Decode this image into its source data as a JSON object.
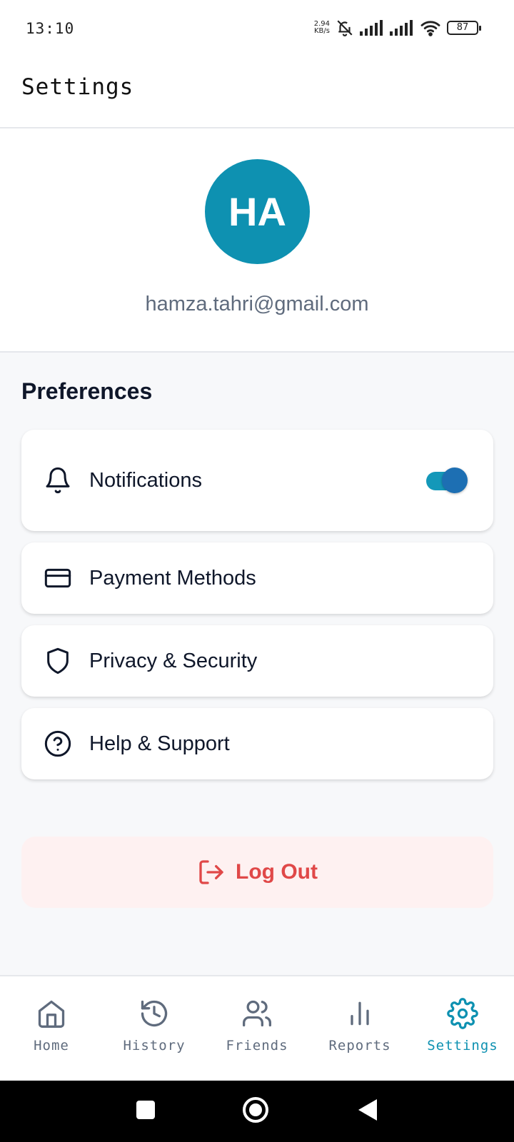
{
  "status_bar": {
    "time": "13:10",
    "net_speed_value": "2.94",
    "net_speed_unit": "KB/s",
    "battery": "87"
  },
  "header": {
    "title": "Settings"
  },
  "profile": {
    "initials": "HA",
    "email": "hamza.tahri@gmail.com",
    "avatar_color": "#0e91b1"
  },
  "preferences": {
    "title": "Preferences",
    "items": [
      {
        "label": "Notifications",
        "icon": "bell-icon",
        "toggle": true
      },
      {
        "label": "Payment Methods",
        "icon": "credit-card-icon"
      },
      {
        "label": "Privacy & Security",
        "icon": "shield-icon"
      },
      {
        "label": "Help & Support",
        "icon": "help-circle-icon"
      }
    ]
  },
  "logout": {
    "label": "Log Out",
    "icon": "logout-icon",
    "color": "#e04848"
  },
  "bottom_nav": {
    "active": "Settings",
    "accent": "#0e91b1",
    "items": [
      {
        "label": "Home",
        "icon": "home-icon"
      },
      {
        "label": "History",
        "icon": "history-icon"
      },
      {
        "label": "Friends",
        "icon": "friends-icon"
      },
      {
        "label": "Reports",
        "icon": "bar-chart-icon"
      },
      {
        "label": "Settings",
        "icon": "gear-icon"
      }
    ]
  }
}
